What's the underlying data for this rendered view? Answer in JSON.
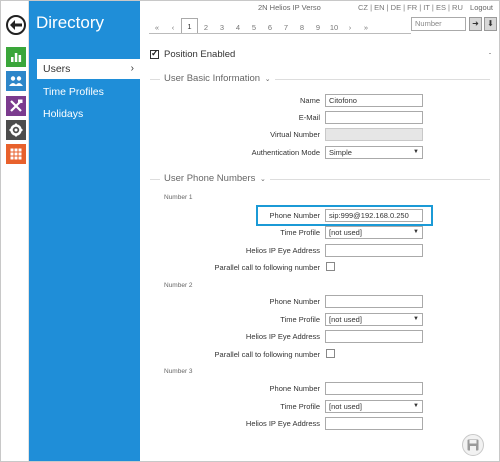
{
  "sidebar": {
    "title": "Directory",
    "items": [
      {
        "label": "Users",
        "active": true
      },
      {
        "label": "Time Profiles",
        "active": false
      },
      {
        "label": "Holidays",
        "active": false
      }
    ],
    "chevron": "›"
  },
  "rail": {
    "icons": [
      "back-arrow-icon",
      "status-chart-icon",
      "directory-users-icon",
      "hardware-tools-icon",
      "services-gear-icon",
      "system-grid-icon"
    ],
    "colors": {
      "status": "#3aa63a",
      "directory": "#2e86c9",
      "hardware": "#7b3b8e",
      "services": "#4c4c4c",
      "system": "#e8612c"
    }
  },
  "topbar": {
    "product": "2N Helios IP Verso",
    "languages": "CZ | EN | DE | FR | IT | ES | RU",
    "logout": "Logout",
    "pager": [
      "«",
      "‹",
      "1",
      "2",
      "3",
      "4",
      "5",
      "6",
      "7",
      "8",
      "9",
      "10",
      "›",
      "»"
    ],
    "current_page": "1",
    "number_placeholder": "Number",
    "go_glyph": "➜",
    "download_glyph": "⬇"
  },
  "main": {
    "position_enabled_label": "Position Enabled",
    "basic_info": {
      "title": "User Basic Information",
      "name_label": "Name",
      "name_value": "Citofono",
      "email_label": "E-Mail",
      "email_value": "",
      "virtual_number_label": "Virtual Number",
      "virtual_number_value": "",
      "auth_mode_label": "Authentication Mode",
      "auth_mode_value": "Simple"
    },
    "phone_numbers": {
      "title": "User Phone Numbers",
      "numbers": [
        {
          "heading": "Number 1",
          "phone_label": "Phone Number",
          "phone_value": "sip:999@192.168.0.250",
          "time_profile_label": "Time Profile",
          "time_profile_value": "[not used]",
          "eye_label": "Helios IP Eye Address",
          "eye_value": "",
          "parallel_label": "Parallel call to following number"
        },
        {
          "heading": "Number 2",
          "phone_label": "Phone Number",
          "phone_value": "",
          "time_profile_label": "Time Profile",
          "time_profile_value": "[not used]",
          "eye_label": "Helios IP Eye Address",
          "eye_value": "",
          "parallel_label": "Parallel call to following number"
        },
        {
          "heading": "Number 3",
          "phone_label": "Phone Number",
          "phone_value": "",
          "time_profile_label": "Time Profile",
          "time_profile_value": "[not used]",
          "eye_label": "Helios IP Eye Address",
          "eye_value": ""
        }
      ]
    },
    "section_arrow": "⌄",
    "select_caret": "▼"
  },
  "accent_color": "#1f8ed8",
  "highlight_color": "#1b9ad6"
}
